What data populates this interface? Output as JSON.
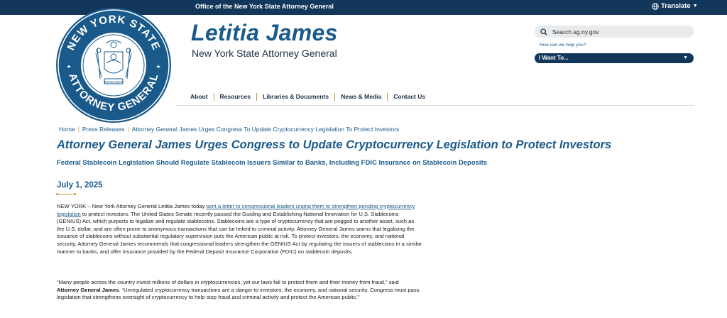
{
  "topbar": {
    "title": "Office of the New York State Attorney General",
    "translate_label": "Translate"
  },
  "seal": {
    "top_text": "NEW YORK STATE",
    "bottom_text": "ATTORNEY GENERAL",
    "motto": "EXCELSIOR"
  },
  "header": {
    "name": "Letitia James",
    "subtitle": "New York State Attorney General"
  },
  "search": {
    "placeholder": "Search ag.ny.gov",
    "help": "How can we help you?",
    "iwant_label": "I Want To..."
  },
  "nav": {
    "items": [
      {
        "label": "About"
      },
      {
        "label": "Resources"
      },
      {
        "label": "Libraries & Documents"
      },
      {
        "label": "News & Media"
      },
      {
        "label": "Contact Us"
      }
    ]
  },
  "breadcrumb": {
    "items": [
      {
        "label": "Home"
      },
      {
        "label": "Press Releases"
      },
      {
        "label": "Attorney General James Urges Congress To Update Cryptocurrency Legislation To Protect Investors"
      }
    ]
  },
  "article": {
    "title": "Attorney General James Urges Congress to Update Cryptocurrency Legislation to Protect Investors",
    "subtitle": "Federal Stablecoin Legislation Should Regulate Stablecoin Issuers Similar to Banks, Including FDIC Insurance on Stablecoin Deposits",
    "date": "July 1, 2025",
    "p1_intro": "NEW YORK – New York Attorney General Letitia James today ",
    "p1_link": "sent a letter to congressional leaders urging them to strengthen pending cryptocurrency legislation",
    "p1_rest": " to protect investors. The United States Senate recently passed the Guiding and Establishing National Innovation for U.S. Stablecoins (GENIUS) Act, which purports to legalize and regulate stablecoins. Stablecoins are a type of cryptocurrency that are pegged to another asset, such as the U.S. dollar, and are often prone to anonymous transactions that can be linked to criminal activity. Attorney General James warns that legalizing the issuance of stablecoins without substantial regulatory supervision puts the American public at risk. To protect investors, the economy, and national security, Attorney General James recommends that congressional leaders strengthen the GENIUS Act by regulating the issuers of stablecoins in a similar manner to banks, and offer insurance provided by the Federal Deposit Insurance Corporation (FDIC) on stablecoin deposits.",
    "p2_a": "“Many people across the country invest millions of dollars in cryptocurrencies, yet our laws fail to protect them and their money from fraud,” said ",
    "p2_bold": "Attorney General James",
    "p2_b": ". “Unregulated cryptocurrency transactions are a danger to investors, the economy, and national security. Congress must pass legislation that strengthens oversight of cryptocurrency to help stop fraud and criminal activity and protect the American public.”"
  },
  "colors": {
    "navy": "#12375a",
    "blue": "#1a5a8a",
    "gold": "#c99a3a"
  }
}
